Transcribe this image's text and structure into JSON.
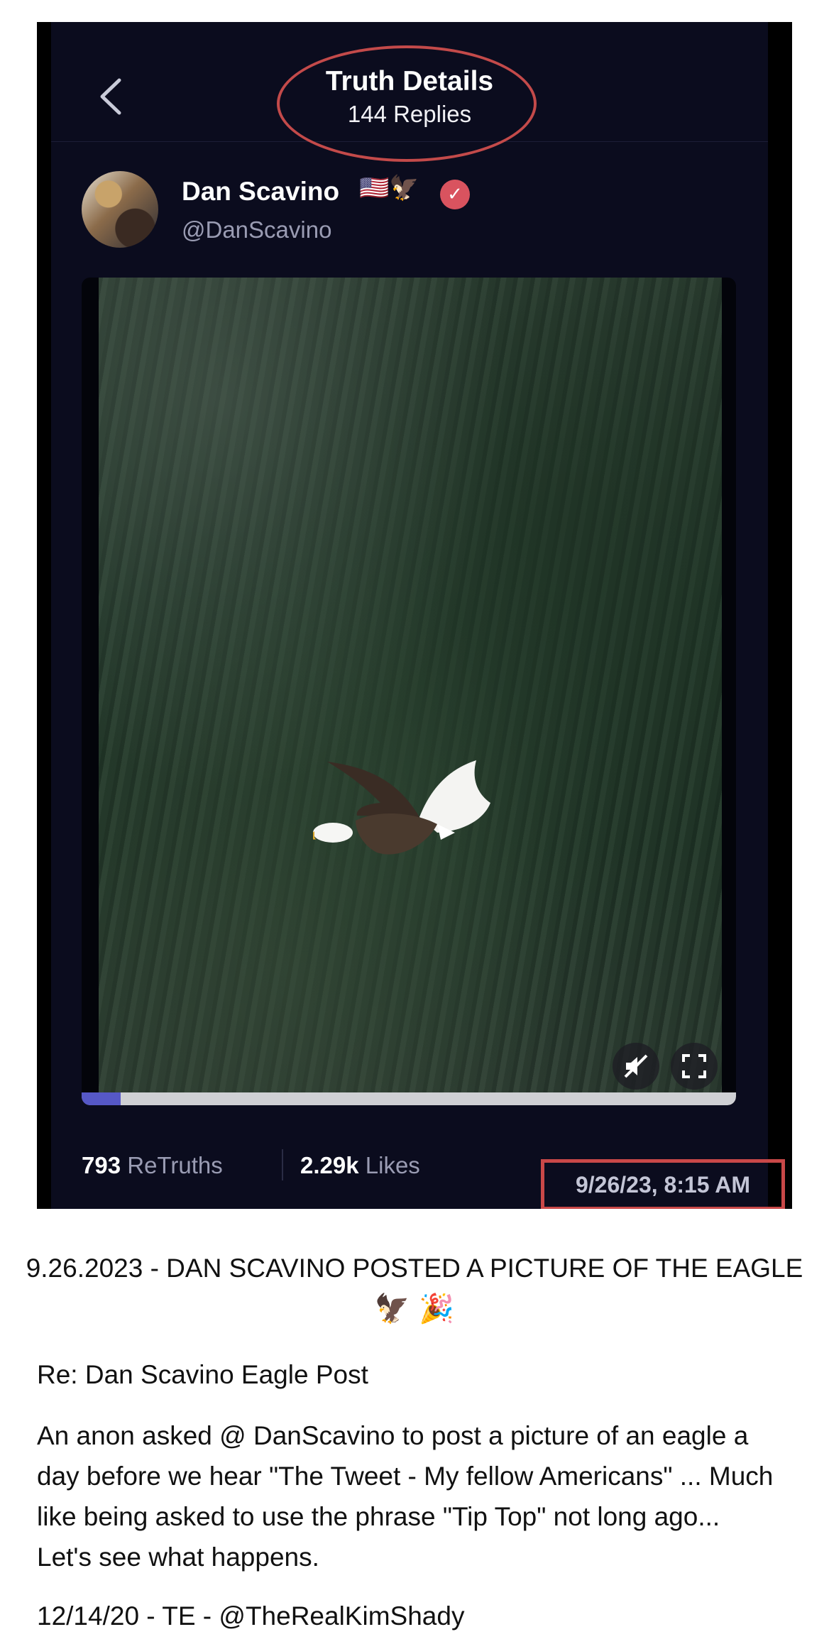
{
  "post": {
    "header_title": "Truth Details",
    "header_subtitle": "144 Replies",
    "author_name": "Dan Scavino",
    "author_emojis": "🇺🇸🦅",
    "verified_mark": "✓",
    "author_handle": "@DanScavino",
    "video_progress": 0.06,
    "retruths_count": "793",
    "retruths_label": "ReTruths",
    "likes_count": "2.29k",
    "likes_label": "Likes",
    "timestamp": "9/26/23, 8:15 AM"
  },
  "icons": [
    "back-chevron-icon",
    "verified-icon",
    "mute-icon",
    "fullscreen-icon"
  ],
  "colors": {
    "app_background": "#0b0c1e",
    "highlight_red": "#c94848",
    "verified": "#d9535f",
    "progress": "#5658c7"
  },
  "caption": {
    "headline": "9.26.2023 - DAN SCAVINO POSTED A PICTURE OF THE EAGLE",
    "headline_emoji": "🦅 🎉",
    "re_line": "Re: Dan Scavino Eagle Post",
    "body_lines": [
      "An anon asked @ DanScavino to post a picture of  an eagle a",
      "day before we hear \"The Tweet - My fellow Americans\" ... Much",
      "like being asked to use the phrase \"Tip Top\" not long ago...",
      "Let's see what happens."
    ],
    "signature": "12/14/20 - TE - @TheRealKimShady"
  }
}
